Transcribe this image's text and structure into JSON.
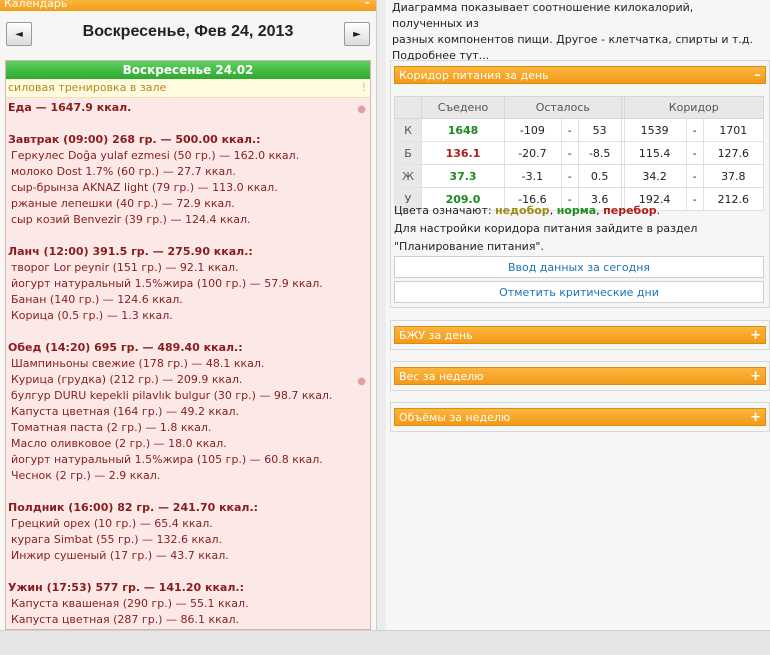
{
  "calendar": {
    "header": "Календарь",
    "collapse_symbol": "–",
    "prev_symbol": "◄",
    "next_symbol": "►",
    "date_title": "Воскресенье, Фев 24, 2013"
  },
  "day": {
    "header": "Воскресенье 24.02",
    "activity": "силовая тренировка в зале",
    "activity_mark": "!",
    "food_total": "Еда — 1647.9 ккал.",
    "meals": [
      {
        "title": "Завтрак (09:00) 268 гр. — 500.00 ккал.:",
        "items": [
          "Геркулес Doğa yulaf ezmesi (50 гр.) — 162.0 ккал.",
          "молоко Dost 1.7% (60 гр.) — 27.7 ккал.",
          "сыр-брынза AKNAZ light (79 гр.) — 113.0 ккал.",
          "ржаные лепешки (40 гр.) — 72.9 ккал.",
          "сыр козий Benvezir (39 гр.) — 124.4 ккал."
        ]
      },
      {
        "title": "Ланч (12:00) 391.5 гр. — 275.90 ккал.:",
        "items": [
          "творог Lor peynir (151 гр.) — 92.1 ккал.",
          "йогурт натуральный 1.5%жира (100 гр.) — 57.9 ккал.",
          "Банан (140 гр.) — 124.6 ккал.",
          "Корица (0.5 гр.) — 1.3 ккал."
        ]
      },
      {
        "title": "Обед (14:20) 695 гр. — 489.40 ккал.:",
        "items": [
          "Шампиньоны свежие (178 гр.) — 48.1 ккал.",
          "Курица (грудка) (212 гр.) — 209.9 ккал.",
          "булгур DURU kepekli pilavlık bulgur (30 гр.) — 98.7 ккал.",
          "Капуста цветная (164 гр.) — 49.2 ккал.",
          "Томатная паста (2 гр.) — 1.8 ккал.",
          "Масло оливковое (2 гр.) — 18.0 ккал.",
          "йогурт натуральный 1.5%жира (105 гр.) — 60.8 ккал.",
          "Чеснок (2 гр.) — 2.9 ккал."
        ]
      },
      {
        "title": "Полдник (16:00) 82 гр. — 241.70 ккал.:",
        "items": [
          "Грецкий орех (10 гр.) — 65.4 ккал.",
          "курага Simbat (55 гр.) — 132.6 ккал.",
          "Инжир сушеный (17 гр.) — 43.7 ккал."
        ]
      },
      {
        "title": "Ужин (17:53) 577 гр. — 141.20 ккал.:",
        "items": [
          "Капуста квашеная (290 гр.) — 55.1 ккал.",
          "Капуста цветная (287 гр.) — 86.1 ккал."
        ]
      }
    ]
  },
  "description": {
    "line1": "Диаграмма показывает соотношение килокалорий, полученных из",
    "line2": "разных компонентов пищи. Другое - клетчатка, спирты и т.д.",
    "more": "Подробнее тут..."
  },
  "corridor": {
    "title": "Коридор питания за день",
    "sign": "–",
    "columns": [
      "Съедено",
      "Осталось",
      "Коридор"
    ],
    "rows": [
      {
        "label": "К",
        "eaten": "1648",
        "eaten_color": "#1c8a1c",
        "rem_from": "-109",
        "rem_to": "53",
        "cor_from": "1539",
        "cor_to": "1701"
      },
      {
        "label": "Б",
        "eaten": "136.1",
        "eaten_color": "#b01c1c",
        "rem_from": "-20.7",
        "rem_to": "-8.5",
        "cor_from": "115.4",
        "cor_to": "127.6"
      },
      {
        "label": "Ж",
        "eaten": "37.3",
        "eaten_color": "#1c8a1c",
        "rem_from": "-3.1",
        "rem_to": "0.5",
        "cor_from": "34.2",
        "cor_to": "37.8"
      },
      {
        "label": "У",
        "eaten": "209.0",
        "eaten_color": "#1c8a1c",
        "rem_from": "-16.6",
        "rem_to": "3.6",
        "cor_from": "192.4",
        "cor_to": "212.6"
      }
    ],
    "legend_prefix": "Цвета означают:",
    "legend_low": "недобор",
    "legend_ok": "норма",
    "legend_high": "перебор",
    "legend_end": ".",
    "hint_line1": "Для настройки коридора питания зайдите в раздел",
    "hint_line2": "\"Планирование питания\".",
    "btn_enter": "Ввод данных за сегодня",
    "btn_critical": "Отметить критические дни"
  },
  "panels": {
    "bju": "БЖУ за день",
    "weight": "Вес за неделю",
    "volumes": "Объёмы за неделю",
    "expand_sign": "+"
  }
}
